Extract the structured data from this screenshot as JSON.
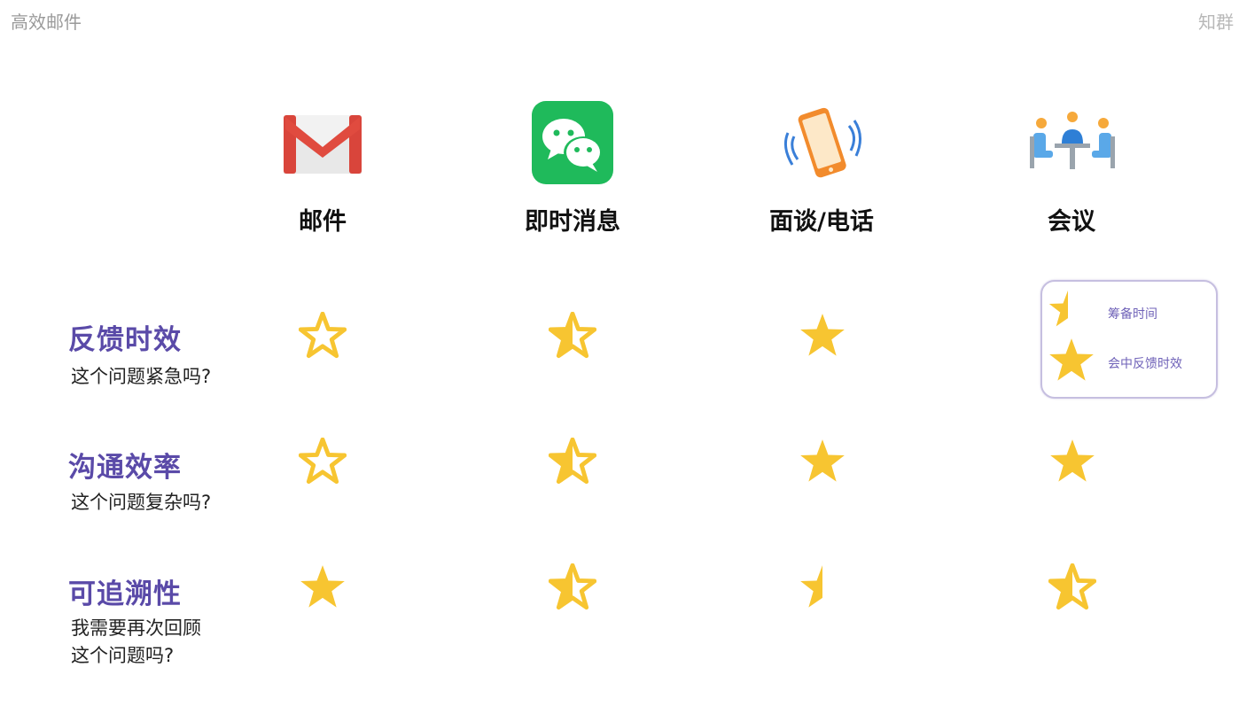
{
  "header": {
    "slide_title": "高效邮件",
    "brand": "知群"
  },
  "columns": [
    {
      "label": "邮件",
      "icon": "gmail-icon"
    },
    {
      "label": "即时消息",
      "icon": "wechat-icon"
    },
    {
      "label": "面谈/电话",
      "icon": "phone-vibrate-icon"
    },
    {
      "label": "会议",
      "icon": "meeting-icon"
    }
  ],
  "rows": [
    {
      "title": "反馈时效",
      "subtitle_lines": [
        "这个问题紧急吗?"
      ]
    },
    {
      "title": "沟通效率",
      "subtitle_lines": [
        "这个问题复杂吗?"
      ]
    },
    {
      "title": "可追溯性",
      "subtitle_lines": [
        "我需要再次回顾",
        "这个问题吗?"
      ]
    }
  ],
  "ratings": [
    [
      "outline",
      "half",
      "full",
      "legend"
    ],
    [
      "outline",
      "half",
      "full",
      "full"
    ],
    [
      "full",
      "half",
      "partial",
      "half"
    ]
  ],
  "legend": {
    "item_1": "筹备时间",
    "item_2": "会中反馈时效"
  },
  "colors": {
    "star": "#F7C531",
    "title_purple": "#5A4AA8"
  }
}
